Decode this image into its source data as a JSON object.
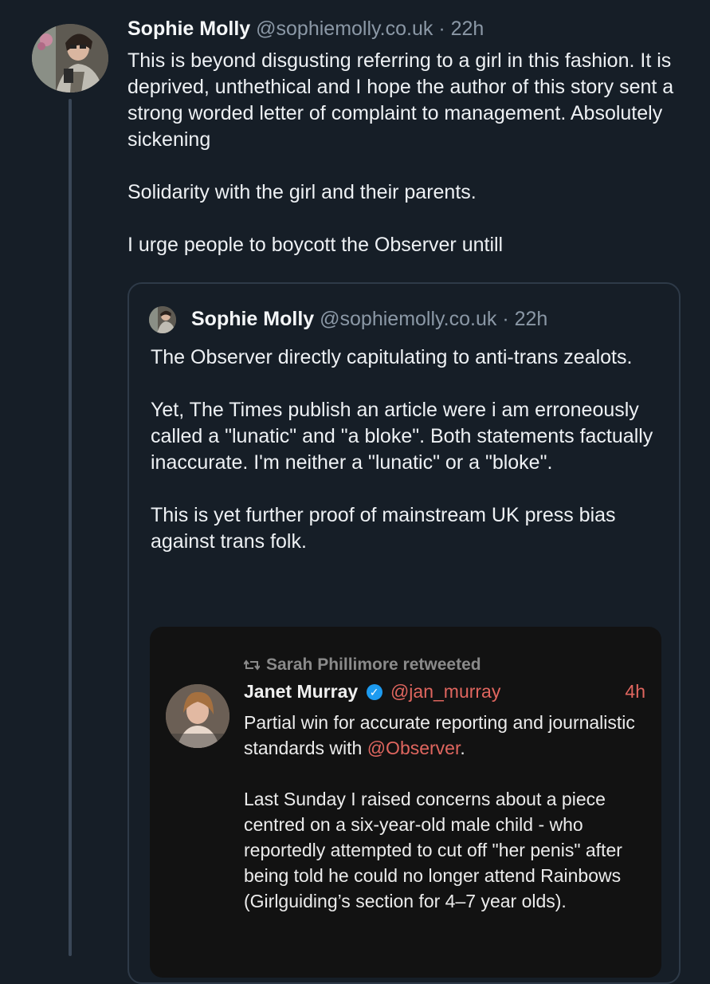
{
  "post": {
    "author_name": "Sophie Molly",
    "author_handle": "@sophiemolly.co.uk",
    "separator": "·",
    "time": "22h",
    "paragraphs": [
      "This is beyond disgusting referring to a girl in this fashion. It is deprived, unthethical and I hope the author of this story sent a strong worded letter of complaint to management. Absolutely sickening",
      "Solidarity with the girl and their parents.",
      "I urge people to boycott the Observer untill"
    ]
  },
  "quote": {
    "author_name": "Sophie Molly",
    "author_handle": "@sophiemolly.co.uk",
    "separator": "·",
    "time": "22h",
    "paragraphs": [
      "The Observer directly capitulating to anti-trans zealots.",
      "Yet, The Times publish an article were i am erroneously called a \"lunatic\" and \"a bloke\". Both statements factually inaccurate. I'm neither a \"lunatic\" or a \"bloke\".",
      "This is yet further proof of mainstream UK press bias against trans folk."
    ]
  },
  "embedded": {
    "retweet_line": "Sarah Phillimore retweeted",
    "retweet_icon": "retweet-icon",
    "author_name": "Janet Murray",
    "verified_icon": "verified-badge-icon",
    "author_handle": "@jan_murray",
    "time": "4h",
    "para1_text": "Partial win for accurate reporting and journalistic standards with ",
    "para1_mention": "@Observer",
    "para1_end": ".",
    "para2": "Last Sunday I raised concerns about a piece centred on a six-year-old male child - who reportedly attempted to cut off \"her penis\" after being told he could no longer attend Rainbows (Girlguiding’s section for 4–7 year olds)."
  },
  "colors": {
    "background": "#161e27",
    "handle_gray": "#8b98a6",
    "mention_red": "#e0665f",
    "verified_blue": "#1d9bf0"
  }
}
